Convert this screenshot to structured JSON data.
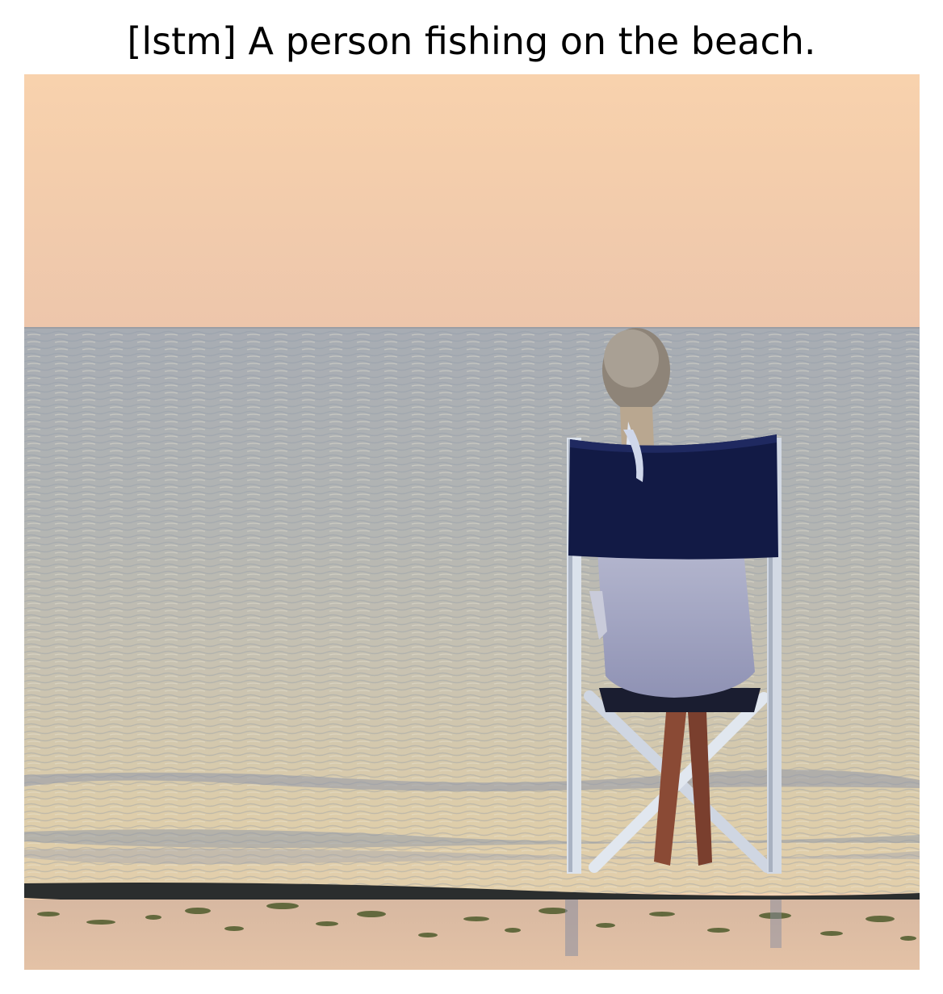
{
  "caption": "[lstm] A person fishing on the beach.",
  "scene": {
    "description_icon": "beach-scene",
    "colors": {
      "sky_top": "#f8d2ad",
      "sky_bottom": "#efc7aa",
      "sea_far": "#a8aeb4",
      "sea_mid": "#bcbcb4",
      "sea_near": "#e2cfa9",
      "shore": "#2c2f2f",
      "sand": "#dab9a0",
      "chair_canvas": "#121a45",
      "chair_frame": "#dfe6ef",
      "shirt": "#a6a7c0",
      "hair": "#91877b"
    }
  }
}
